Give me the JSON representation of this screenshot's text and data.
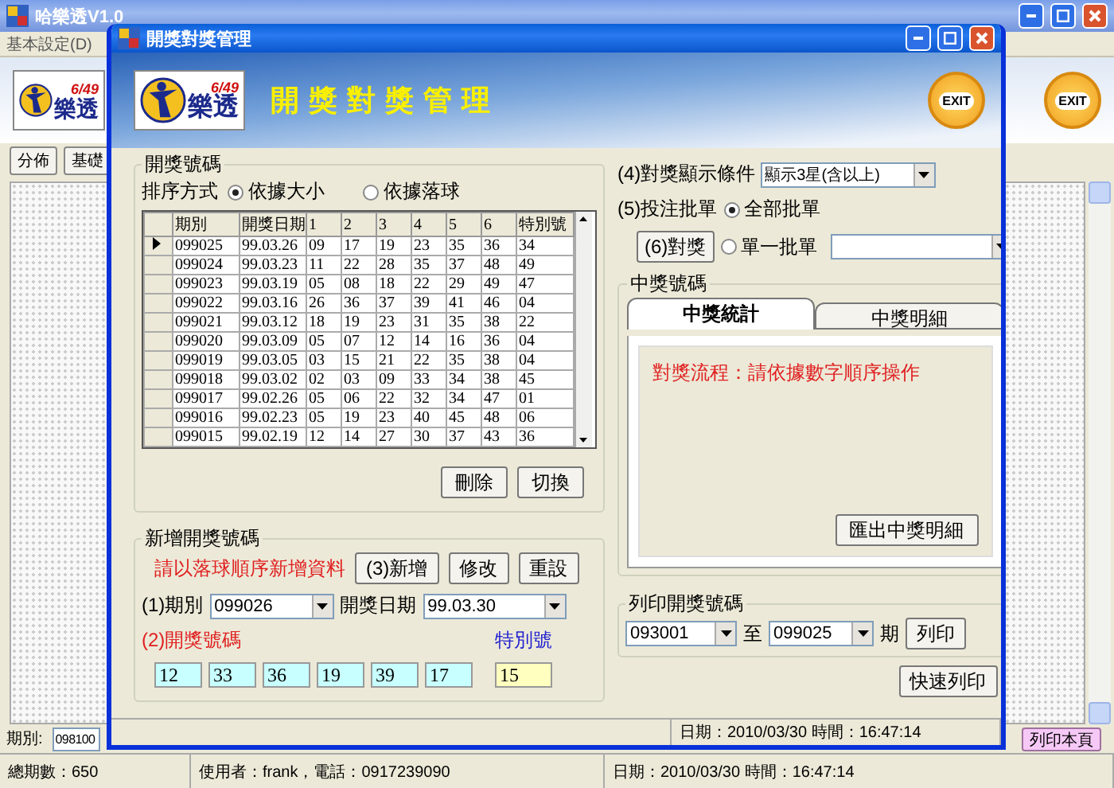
{
  "main_window": {
    "title": "哈樂透V1.0",
    "menu": [
      "基本設定(D)"
    ],
    "logo": {
      "badge": "6/49",
      "name": "樂透"
    },
    "exit_label": "EXIT",
    "toolbar": [
      "分佈",
      "基礎"
    ],
    "period_label": "期別:",
    "period_value": "098100",
    "print_page": "列印本頁",
    "status_bar": [
      "總期數：650",
      "使用者：frank，電話：0917239090",
      "日期：2010/03/30  時間：16:47:14"
    ]
  },
  "dialog": {
    "title": "開獎對獎管理",
    "logo": {
      "badge": "6/49",
      "name": "樂透"
    },
    "banner_title": "開獎對獎管理",
    "exit_label": "EXIT",
    "draw_numbers": {
      "title": "開獎號碼",
      "sort_label": "排序方式",
      "sort_options": [
        {
          "label": "依據大小",
          "selected": true
        },
        {
          "label": "依據落球",
          "selected": false
        }
      ],
      "columns": [
        "期別",
        "開獎日期",
        "1",
        "2",
        "3",
        "4",
        "5",
        "6",
        "特別號"
      ],
      "rows": [
        {
          "current": true,
          "cells": [
            "099025",
            "99.03.26",
            "09",
            "17",
            "19",
            "23",
            "35",
            "36",
            "34"
          ]
        },
        {
          "current": false,
          "cells": [
            "099024",
            "99.03.23",
            "11",
            "22",
            "28",
            "35",
            "37",
            "48",
            "49"
          ]
        },
        {
          "current": false,
          "cells": [
            "099023",
            "99.03.19",
            "05",
            "08",
            "18",
            "22",
            "29",
            "49",
            "47"
          ]
        },
        {
          "current": false,
          "cells": [
            "099022",
            "99.03.16",
            "26",
            "36",
            "37",
            "39",
            "41",
            "46",
            "04"
          ]
        },
        {
          "current": false,
          "cells": [
            "099021",
            "99.03.12",
            "18",
            "19",
            "23",
            "31",
            "35",
            "38",
            "22"
          ]
        },
        {
          "current": false,
          "cells": [
            "099020",
            "99.03.09",
            "05",
            "07",
            "12",
            "14",
            "16",
            "36",
            "04"
          ]
        },
        {
          "current": false,
          "cells": [
            "099019",
            "99.03.05",
            "03",
            "15",
            "21",
            "22",
            "35",
            "38",
            "04"
          ]
        },
        {
          "current": false,
          "cells": [
            "099018",
            "99.03.02",
            "02",
            "03",
            "09",
            "33",
            "34",
            "38",
            "45"
          ]
        },
        {
          "current": false,
          "cells": [
            "099017",
            "99.02.26",
            "05",
            "06",
            "22",
            "32",
            "34",
            "47",
            "01"
          ]
        },
        {
          "current": false,
          "cells": [
            "099016",
            "99.02.23",
            "05",
            "19",
            "23",
            "40",
            "45",
            "48",
            "06"
          ]
        },
        {
          "current": false,
          "cells": [
            "099015",
            "99.02.19",
            "12",
            "14",
            "27",
            "30",
            "37",
            "43",
            "36"
          ]
        }
      ],
      "buttons": [
        "刪除",
        "切換"
      ]
    },
    "add_draw": {
      "title": "新增開獎號碼",
      "hint": "請以落球順序新增資料",
      "buttons": [
        "(3)新增",
        "修改",
        "重設"
      ],
      "period_label": "(1)期別",
      "period_value": "099026",
      "date_label": "開獎日期",
      "date_value": "99.03.30",
      "numbers_label": "(2)開獎號碼",
      "special_label": "特別號",
      "numbers": [
        "12",
        "33",
        "36",
        "19",
        "39",
        "17"
      ],
      "special": "15"
    },
    "match": {
      "condition_label": "(4)對獎顯示條件",
      "condition_value": "顯示3星(含以上)",
      "bet_label": "(5)投注批單",
      "bet_options": [
        {
          "label": "全部批單",
          "selected": true
        },
        {
          "label": "單一批單",
          "selected": false
        }
      ],
      "match_button": "(6)對獎",
      "winning": {
        "title": "中獎號碼",
        "tabs": [
          {
            "label": "中獎統計",
            "selected": true
          },
          {
            "label": "中獎明細",
            "selected": false
          }
        ],
        "message": "對獎流程：請依據數字順序操作",
        "export_button": "匯出中獎明細"
      }
    },
    "print": {
      "title": "列印開獎號碼",
      "from": "093001",
      "to_label": "至",
      "to": "099025",
      "period_suffix": "期",
      "print_button": "列印",
      "quick_print": "快速列印"
    },
    "status": "日期：2010/03/30  時間：16:47:14"
  }
}
